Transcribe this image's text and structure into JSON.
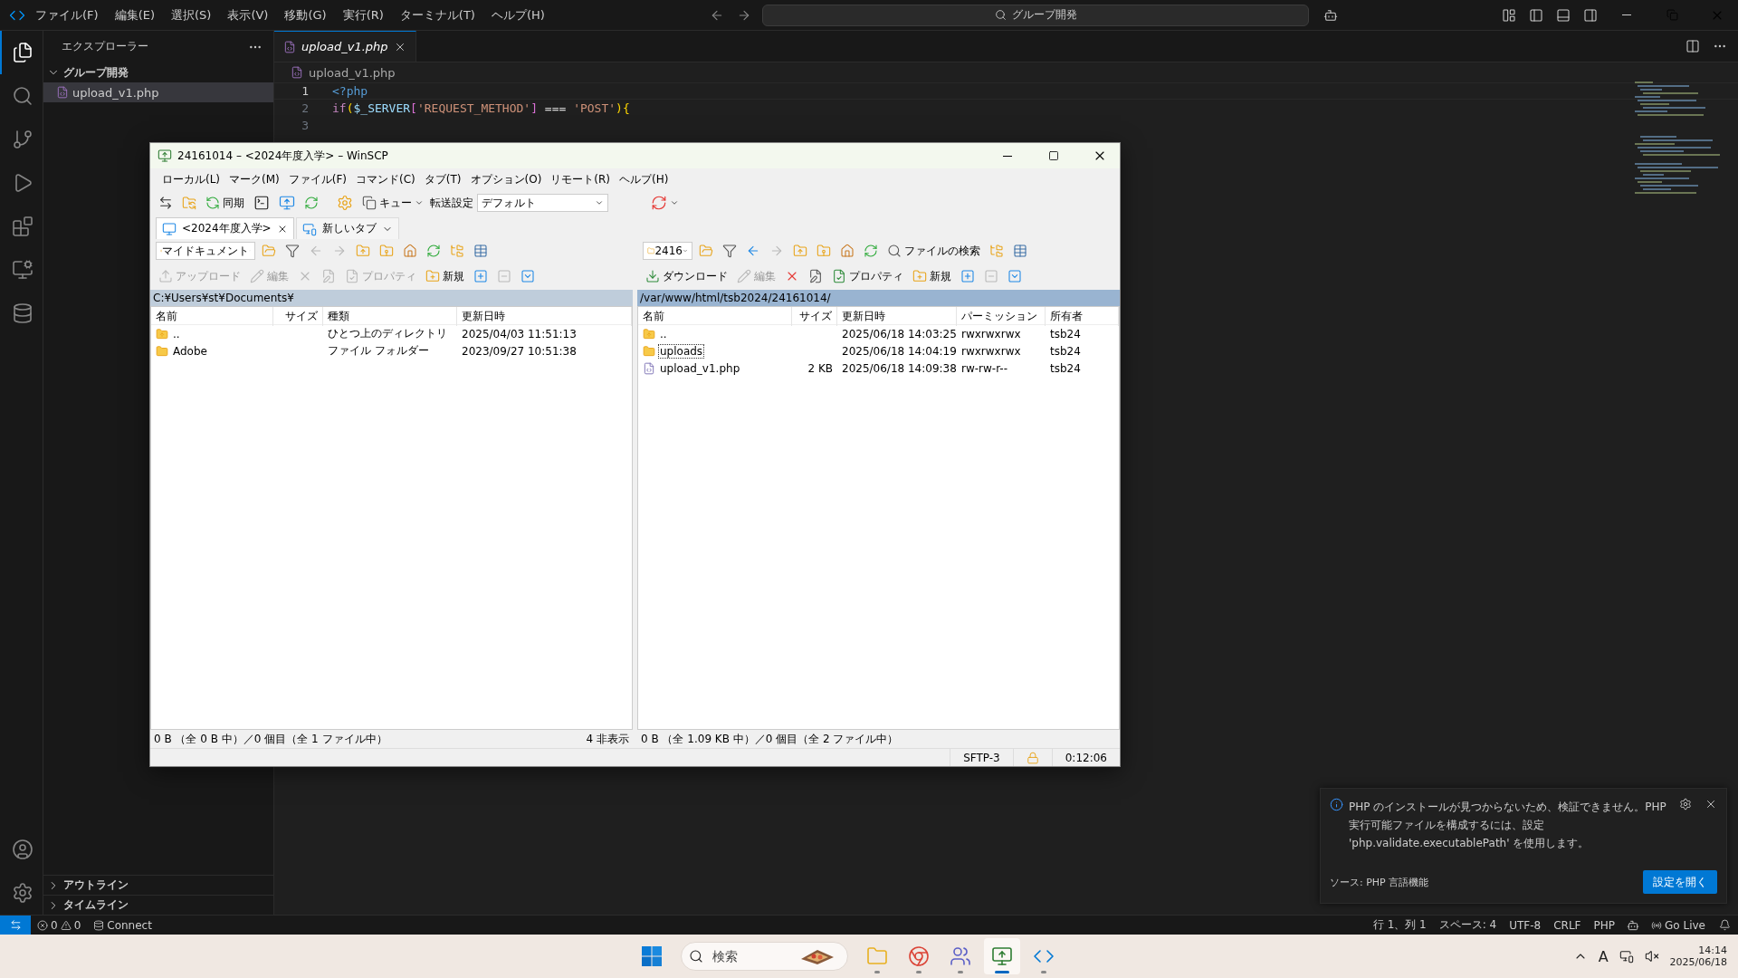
{
  "menu_bar": [
    "ファイル(F)",
    "編集(E)",
    "選択(S)",
    "表示(V)",
    "移動(G)",
    "実行(R)",
    "ターミナル(T)",
    "ヘルプ(H)"
  ],
  "command_center": {
    "value": "グループ開発"
  },
  "activity_bar": [
    {
      "kind": "explorer",
      "selected": true
    },
    {
      "kind": "search",
      "selected": false
    },
    {
      "kind": "scm",
      "selected": false
    },
    {
      "kind": "debug",
      "selected": false
    },
    {
      "kind": "extensions",
      "selected": false
    },
    {
      "kind": "remote",
      "selected": false
    },
    {
      "kind": "database",
      "selected": false
    }
  ],
  "activity_bottom": [
    {
      "kind": "account"
    },
    {
      "kind": "settings"
    }
  ],
  "explorer": {
    "title": "エクスプローラー",
    "folder": {
      "name": "グループ開発",
      "expanded": true,
      "children": [
        {
          "name": "upload_v1.php",
          "selected": true
        }
      ]
    },
    "sections": [
      {
        "label": "アウトライン",
        "expanded": false
      },
      {
        "label": "タイムライン",
        "expanded": false
      }
    ]
  },
  "editor": {
    "tabs": [
      {
        "label": "upload_v1.php",
        "selected": true
      }
    ],
    "breadcrumb": "upload_v1.php",
    "lines": [
      {
        "number": "1",
        "current": true,
        "tokens": [
          {
            "kind": "tag",
            "text": "<?php"
          }
        ]
      },
      {
        "number": "2",
        "current": false,
        "tokens": [
          {
            "kind": "keyword",
            "text": "if"
          },
          {
            "kind": "bracket",
            "text": "("
          },
          {
            "kind": "variable",
            "text": "$_SERVER"
          },
          {
            "kind": "bracket2",
            "text": "["
          },
          {
            "kind": "string",
            "text": "'REQUEST_METHOD'"
          },
          {
            "kind": "bracket2",
            "text": "]"
          },
          {
            "kind": "plain",
            "text": " === "
          },
          {
            "kind": "string",
            "text": "'POST'"
          },
          {
            "kind": "bracket",
            "text": "){"
          }
        ]
      },
      {
        "number": "3",
        "current": false
      }
    ]
  },
  "winscp": {
    "title": "24161014 – <2024年度入学> – WinSCP",
    "menu": [
      "ローカル(L)",
      "マーク(M)",
      "ファイル(F)",
      "コマンド(C)",
      "タブ(T)",
      "オプション(O)",
      "リモート(R)",
      "ヘルプ(H)"
    ],
    "toolbar": {
      "sync": "同期",
      "queue": "キュー",
      "transfer_label": "転送設定",
      "transfer_value": "デフォルト"
    },
    "session_tabs": [
      {
        "label": "<2024年度入学>",
        "selected": true,
        "kind": "session"
      },
      {
        "label": "新しいタブ",
        "selected": false,
        "kind": "new"
      }
    ],
    "panels": [
      {
        "nav": [
          {
            "kind": "drive",
            "label": "マイドキュメント"
          },
          {
            "kind": "open",
            "disabled": false
          },
          {
            "kind": "filter",
            "disabled": false
          },
          {
            "kind": "back",
            "disabled": true
          },
          {
            "kind": "forward",
            "disabled": true
          },
          {
            "kind": "parent",
            "disabled": false
          },
          {
            "kind": "root",
            "disabled": false
          },
          {
            "kind": "home",
            "disabled": false
          },
          {
            "kind": "refresh",
            "disabled": false
          },
          {
            "kind": "tree",
            "disabled": false
          },
          {
            "kind": "view",
            "disabled": false
          }
        ],
        "actions": [
          {
            "kind": "upload",
            "label": "アップロード",
            "disabled": true
          },
          {
            "kind": "edit",
            "label": "編集",
            "disabled": true
          },
          {
            "kind": "delete",
            "disabled": true
          },
          {
            "kind": "rename",
            "disabled": true
          },
          {
            "kind": "properties",
            "label": "プロパティ",
            "disabled": true
          },
          {
            "kind": "new",
            "label": "新規",
            "disabled": false
          },
          {
            "kind": "plus",
            "disabled": false
          },
          {
            "kind": "minus",
            "disabled": true
          },
          {
            "kind": "selectfilter",
            "disabled": false
          }
        ],
        "path": "C:¥Users¥st¥Documents¥",
        "active": false,
        "columns": [
          "名前",
          "サイズ",
          "種類",
          "更新日時"
        ],
        "rows": [
          {
            "kind": "parent",
            "focused": false,
            "cells": [
              "..",
              "",
              "ひとつ上のディレクトリ",
              "2025/04/03 11:51:13"
            ]
          },
          {
            "kind": "folder",
            "focused": false,
            "cells": [
              "Adobe",
              "",
              "ファイル フォルダー",
              "2023/09/27 10:51:38"
            ]
          }
        ],
        "status": "0 B （全 0 B 中）／0 個目（全 1 ファイル中）",
        "hidden": "4 非表示"
      },
      {
        "nav": [
          {
            "kind": "drive",
            "label": "2416"
          },
          {
            "kind": "open",
            "disabled": false
          },
          {
            "kind": "filter",
            "disabled": false
          },
          {
            "kind": "back",
            "disabled": false
          },
          {
            "kind": "forward",
            "disabled": true
          },
          {
            "kind": "parent",
            "disabled": false
          },
          {
            "kind": "root",
            "disabled": false
          },
          {
            "kind": "home",
            "disabled": false
          },
          {
            "kind": "refresh",
            "disabled": false
          },
          {
            "kind": "find",
            "label": "ファイルの検索",
            "disabled": false
          },
          {
            "kind": "tree",
            "disabled": false
          },
          {
            "kind": "view",
            "disabled": false
          }
        ],
        "actions": [
          {
            "kind": "download",
            "label": "ダウンロード",
            "disabled": false
          },
          {
            "kind": "edit",
            "label": "編集",
            "disabled": true
          },
          {
            "kind": "delete",
            "disabled": false
          },
          {
            "kind": "rename",
            "disabled": false
          },
          {
            "kind": "properties",
            "label": "プロパティ",
            "disabled": false
          },
          {
            "kind": "new",
            "label": "新規",
            "disabled": false
          },
          {
            "kind": "plus",
            "disabled": false
          },
          {
            "kind": "minus",
            "disabled": true
          },
          {
            "kind": "selectfilter",
            "disabled": false
          }
        ],
        "path": "/var/www/html/tsb2024/24161014/",
        "active": true,
        "columns": [
          "名前",
          "サイズ",
          "更新日時",
          "パーミッション",
          "所有者"
        ],
        "rows": [
          {
            "kind": "parent",
            "focused": false,
            "cells": [
              "..",
              "",
              "2025/06/18 14:03:25",
              "rwxrwxrwx",
              "tsb24"
            ]
          },
          {
            "kind": "folder",
            "focused": true,
            "cells": [
              "uploads",
              "",
              "2025/06/18 14:04:19",
              "rwxrwxrwx",
              "tsb24"
            ]
          },
          {
            "kind": "php",
            "focused": false,
            "cells": [
              "upload_v1.php",
              "2 KB",
              "2025/06/18 14:09:38",
              "rw-rw-r--",
              "tsb24"
            ]
          }
        ],
        "status": "0 B （全 1.09 KB 中）／0 個目（全 2 ファイル中）"
      }
    ],
    "status_bar": {
      "protocol": "SFTP-3",
      "elapsed": "0:12:06"
    }
  },
  "notification": {
    "message": "PHP のインストールが見つからないため、検証できません。PHP 実行可能ファイルを構成するには、設定 'php.validate.executablePath' を使用します。",
    "source": "ソース: PHP 言語機能",
    "button": "設定を開く"
  },
  "status_bar": {
    "errors": "0",
    "warnings": "0",
    "connect": "Connect",
    "right": [
      "行 1、列 1",
      "スペース: 4",
      "UTF-8",
      "CRLF",
      "PHP"
    ],
    "golive": "Go Live"
  },
  "taskbar": {
    "search": {
      "placeholder": "検索"
    },
    "apps": [
      {
        "kind": "explorer",
        "running": true,
        "active": false
      },
      {
        "kind": "chrome",
        "running": true,
        "active": false
      },
      {
        "kind": "teams",
        "running": true,
        "active": false
      },
      {
        "kind": "winscp",
        "running": true,
        "active": true
      },
      {
        "kind": "vscode",
        "running": true,
        "active": false
      }
    ],
    "ime": "A",
    "time": "14:14",
    "date": "2025/06/18"
  }
}
